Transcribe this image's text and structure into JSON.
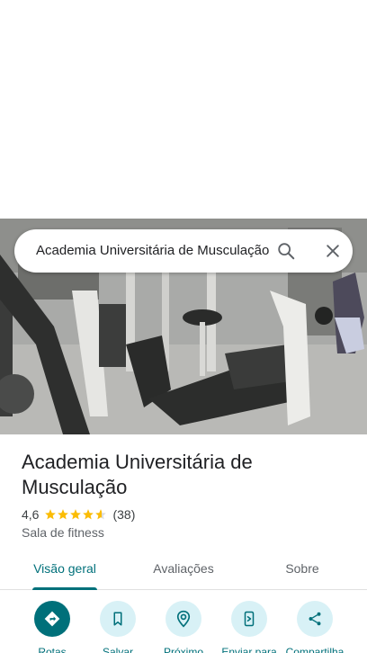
{
  "search": {
    "query": "Academia Universitária de Musculação",
    "search_icon": "search-icon",
    "close_icon": "close-icon"
  },
  "place": {
    "name": "Academia Universitária de Musculação",
    "rating": "4,6",
    "rating_stars": 4.6,
    "reviews_count": "(38)",
    "category": "Sala de fitness"
  },
  "tabs": [
    {
      "label": "Visão geral",
      "active": true
    },
    {
      "label": "Avaliações",
      "active": false
    },
    {
      "label": "Sobre",
      "active": false
    }
  ],
  "actions": [
    {
      "label": "Rotas",
      "icon": "directions-icon"
    },
    {
      "label": "Salvar",
      "icon": "bookmark-icon"
    },
    {
      "label": "Próximo",
      "icon": "nearby-icon"
    },
    {
      "label": "Enviar para",
      "icon": "send-to-phone-icon"
    },
    {
      "label": "Compartilha",
      "icon": "share-icon"
    }
  ],
  "colors": {
    "accent": "#00707a",
    "accent_light": "#d8f1f6",
    "star": "#fbbc04"
  }
}
